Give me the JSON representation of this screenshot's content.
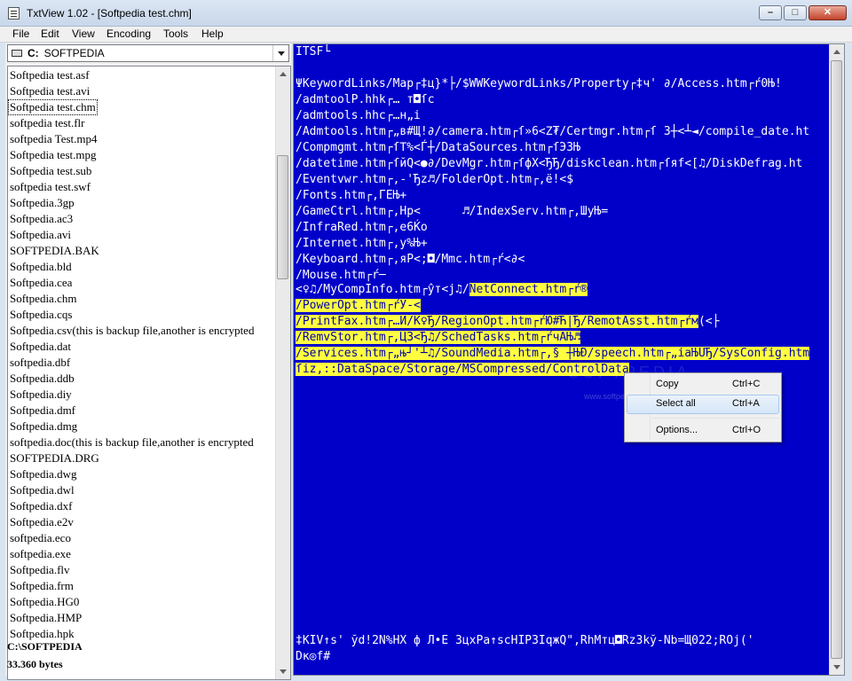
{
  "window": {
    "title": "TxtView 1.02 - [Softpedia test.chm]",
    "minimize": "–",
    "maximize": "□",
    "close": "✕"
  },
  "menu": [
    "File",
    "Edit",
    "View",
    "Encoding",
    "Tools",
    "Help"
  ],
  "drive": {
    "letter": "C:",
    "label": "SOFTPEDIA"
  },
  "files": [
    "Softpedia test.asf",
    "Softpedia test.avi",
    "Softpedia test.chm",
    "softpedia test.flr",
    "softpedia Test.mp4",
    "Softpedia test.mpg",
    "Softpedia test.sub",
    "softpedia test.swf",
    "Softpedia.3gp",
    "Softpedia.ac3",
    "Softpedia.avi",
    "SOFTPEDIA.BAK",
    "Softpedia.bld",
    "Softpedia.cea",
    "Softpedia.chm",
    "Softpedia.cqs",
    "Softpedia.csv(this is backup file,another is encrypted",
    "Softpedia.dat",
    "softpedia.dbf",
    "Softpedia.ddb",
    "Softpedia.diy",
    "Softpedia.dmf",
    "Softpedia.dmg",
    "softpedia.doc(this is backup file,another is encrypted",
    "SOFTPEDIA.DRG",
    "Softpedia.dwg",
    "Softpedia.dwl",
    "Softpedia.dxf",
    "Softpedia.e2v",
    "softpedia.eco",
    "softpedia.exe",
    "Softpedia.flv",
    "Softpedia.frm",
    "Softpedia.HG0",
    "Softpedia.HMP",
    "Softpedia.hpk"
  ],
  "selected_file_index": 2,
  "status": {
    "path": "C:\\SOFTPEDIA",
    "size": "33.360 bytes"
  },
  "text_lines": [
    "ITSF└",
    "",
    "ΨKeywordLinks/Map┌‡ц}*├/$WWKeywordLinks/Property┌‡ч' ∂/Access.htm┌ŕ0Њ!",
    "/admtoolP.hhk┌… т◘ſc",
    "/admtools.hhc┌…н„i",
    "/Admtools.htm┌„в#Щ!∂/camera.htm┌ſ»6<Ζ₮/Certmgr.htm┌ſ 3┼<┴◄/compile_date.ht",
    "/Compmgmt.htm┌ſΤ%<Ѓ┼/DataSources.htm┌ſЭ3Њ",
    "/datetime.htm┌ſйQ<●∂/DevMgr.htm┌ſфX<ЂЂ/diskclean.htm┌ſяf<[♫/DiskDefrag.ht",
    "/Eventvwr.htm┌‚-'Ђz♬/FolderOpt.htm┌‚ё!<$",
    "/Fonts.htm┌‚ГЕЊ+",
    "/GameCtrl.htm┌‚Нр<      ♬/IndexServ.htm┌‚ШуЊ=",
    "/InfraRed.htm┌‚е6Ќo",
    "/Internet.htm┌‚у%Њ+",
    "/Keyboard.htm┌‚яР<;◘/Mmc.htm┌ŕ<∂<",
    "/Mouse.htm┌ŕ─",
    "<♀♫/MyCompInfo.htm┌ŷт<j♫/"
  ],
  "highlight_segments": {
    "line15_hl": "NetConnect.htm┌ŕ®",
    "line16": "/PowerOpt.htm┌ŕУ-<",
    "line17": "/PrintFax.htm┌…И/K♀Ђ/RegionOpt.htm┌ŕЮ#Ћ|Ђ/RemotAsst.htm┌ŕм",
    "line17_tail": "(<├",
    "line18": "/RemvStor.htm┌‚Ц3<Ђ♫/SchedTasks.htm┌ŕчАЊ♬",
    "line19": "/Services.htm┌„њ┘'┴♫/SoundMedia.htm┌‚§ ┼ЊĐ/speech.htm┌„iaЊUЂ/SysConfig.htm",
    "line20": "ſiz,::DataSpace/Storage/MSCompressed/ControlData"
  },
  "bottom_lines": [
    "‡KIV↑s' ўd!2N%HX ф Л•Е 3цхРа↑scHIP3IqжQ\",RhMтц◘Rz3kў-Nb=Щ022;RОj('",
    "Dк◎f#"
  ],
  "watermark": {
    "text": "SOFTPEDIA",
    "sub": "www.softpedia.com"
  },
  "context_menu": [
    {
      "label": "Copy",
      "shortcut": "Ctrl+C"
    },
    {
      "label": "Select all",
      "shortcut": "Ctrl+A"
    },
    {
      "label": "Options...",
      "shortcut": "Ctrl+O"
    }
  ],
  "colors": {
    "text_bg": "#0000c8",
    "highlight": "#ffff40"
  }
}
